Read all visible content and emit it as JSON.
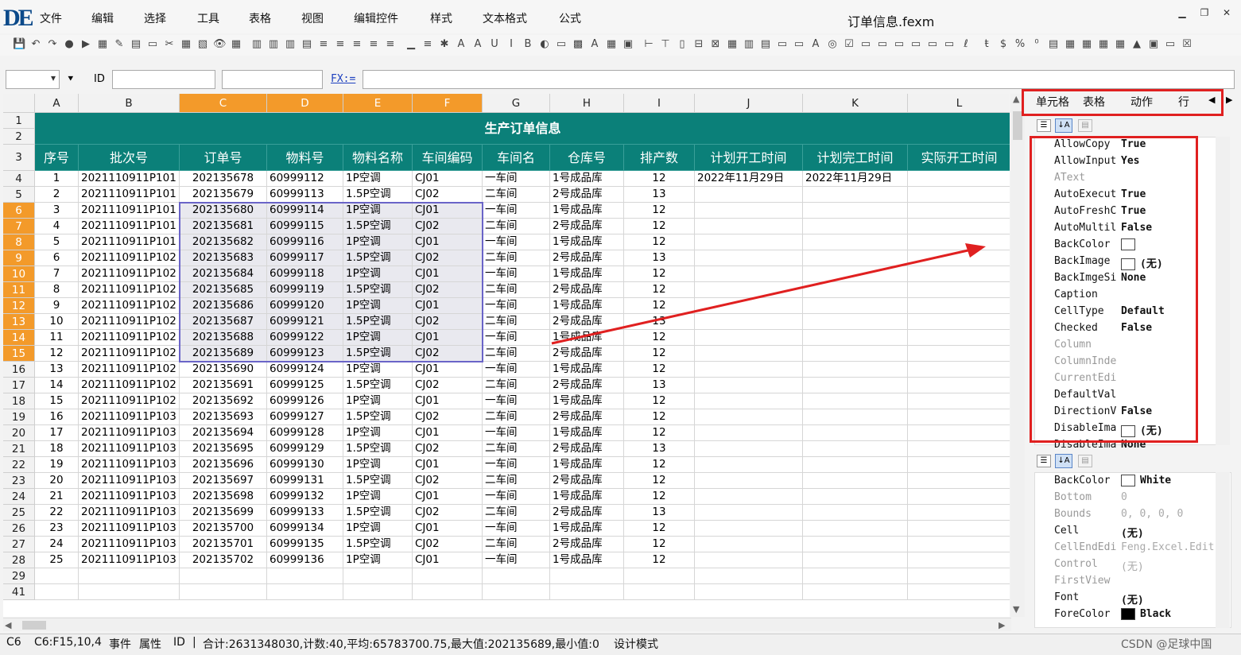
{
  "app": {
    "logo": "DE",
    "title": "订单信息.fexm"
  },
  "menu": [
    "文件",
    "编辑",
    "选择",
    "工具",
    "表格",
    "视图",
    "编辑控件",
    "样式",
    "文本格式",
    "公式"
  ],
  "formula_bar": {
    "id_label": "ID",
    "fx_label": "FX:=",
    "dropdown_arrow": "▾",
    "pin": "⯆"
  },
  "columns": [
    "A",
    "B",
    "C",
    "D",
    "E",
    "F",
    "G",
    "H",
    "I",
    "J",
    "K",
    "L"
  ],
  "sheet_title": "生产订单信息",
  "headers": [
    "序号",
    "批次号",
    "订单号",
    "物料号",
    "物料名称",
    "车间编码",
    "车间名",
    "仓库号",
    "排产数",
    "计划开工时间",
    "计划完工时间",
    "实际开工时间"
  ],
  "rows": [
    [
      "1",
      "2021110911P101",
      "202135678",
      "60999112",
      "1P空调",
      "CJ01",
      "一车间",
      "1号成品库",
      "12",
      "2022年11月29日",
      "2022年11月29日"
    ],
    [
      "2",
      "2021110911P101",
      "202135679",
      "60999113",
      "1.5P空调",
      "CJ02",
      "二车间",
      "2号成品库",
      "13",
      "",
      ""
    ],
    [
      "3",
      "2021110911P101",
      "202135680",
      "60999114",
      "1P空调",
      "CJ01",
      "一车间",
      "1号成品库",
      "12",
      "",
      ""
    ],
    [
      "4",
      "2021110911P101",
      "202135681",
      "60999115",
      "1.5P空调",
      "CJ02",
      "二车间",
      "2号成品库",
      "12",
      "",
      ""
    ],
    [
      "5",
      "2021110911P101",
      "202135682",
      "60999116",
      "1P空调",
      "CJ01",
      "一车间",
      "1号成品库",
      "12",
      "",
      ""
    ],
    [
      "6",
      "2021110911P102",
      "202135683",
      "60999117",
      "1.5P空调",
      "CJ02",
      "二车间",
      "2号成品库",
      "13",
      "",
      ""
    ],
    [
      "7",
      "2021110911P102",
      "202135684",
      "60999118",
      "1P空调",
      "CJ01",
      "一车间",
      "1号成品库",
      "12",
      "",
      ""
    ],
    [
      "8",
      "2021110911P102",
      "202135685",
      "60999119",
      "1.5P空调",
      "CJ02",
      "二车间",
      "2号成品库",
      "12",
      "",
      ""
    ],
    [
      "9",
      "2021110911P102",
      "202135686",
      "60999120",
      "1P空调",
      "CJ01",
      "一车间",
      "1号成品库",
      "12",
      "",
      ""
    ],
    [
      "10",
      "2021110911P102",
      "202135687",
      "60999121",
      "1.5P空调",
      "CJ02",
      "二车间",
      "2号成品库",
      "13",
      "",
      ""
    ],
    [
      "11",
      "2021110911P102",
      "202135688",
      "60999122",
      "1P空调",
      "CJ01",
      "一车间",
      "1号成品库",
      "12",
      "",
      ""
    ],
    [
      "12",
      "2021110911P102",
      "202135689",
      "60999123",
      "1.5P空调",
      "CJ02",
      "二车间",
      "2号成品库",
      "12",
      "",
      ""
    ],
    [
      "13",
      "2021110911P102",
      "202135690",
      "60999124",
      "1P空调",
      "CJ01",
      "一车间",
      "1号成品库",
      "12",
      "",
      ""
    ],
    [
      "14",
      "2021110911P102",
      "202135691",
      "60999125",
      "1.5P空调",
      "CJ02",
      "二车间",
      "2号成品库",
      "13",
      "",
      ""
    ],
    [
      "15",
      "2021110911P102",
      "202135692",
      "60999126",
      "1P空调",
      "CJ01",
      "一车间",
      "1号成品库",
      "12",
      "",
      ""
    ],
    [
      "16",
      "2021110911P103",
      "202135693",
      "60999127",
      "1.5P空调",
      "CJ02",
      "二车间",
      "2号成品库",
      "12",
      "",
      ""
    ],
    [
      "17",
      "2021110911P103",
      "202135694",
      "60999128",
      "1P空调",
      "CJ01",
      "一车间",
      "1号成品库",
      "12",
      "",
      ""
    ],
    [
      "18",
      "2021110911P103",
      "202135695",
      "60999129",
      "1.5P空调",
      "CJ02",
      "二车间",
      "2号成品库",
      "13",
      "",
      ""
    ],
    [
      "19",
      "2021110911P103",
      "202135696",
      "60999130",
      "1P空调",
      "CJ01",
      "一车间",
      "1号成品库",
      "12",
      "",
      ""
    ],
    [
      "20",
      "2021110911P103",
      "202135697",
      "60999131",
      "1.5P空调",
      "CJ02",
      "二车间",
      "2号成品库",
      "12",
      "",
      ""
    ],
    [
      "21",
      "2021110911P103",
      "202135698",
      "60999132",
      "1P空调",
      "CJ01",
      "一车间",
      "1号成品库",
      "12",
      "",
      ""
    ],
    [
      "22",
      "2021110911P103",
      "202135699",
      "60999133",
      "1.5P空调",
      "CJ02",
      "二车间",
      "2号成品库",
      "13",
      "",
      ""
    ],
    [
      "23",
      "2021110911P103",
      "202135700",
      "60999134",
      "1P空调",
      "CJ01",
      "一车间",
      "1号成品库",
      "12",
      "",
      ""
    ],
    [
      "24",
      "2021110911P103",
      "202135701",
      "60999135",
      "1.5P空调",
      "CJ02",
      "二车间",
      "2号成品库",
      "12",
      "",
      ""
    ],
    [
      "25",
      "2021110911P103",
      "202135702",
      "60999136",
      "1P空调",
      "CJ01",
      "一车间",
      "1号成品库",
      "12",
      "",
      ""
    ]
  ],
  "row_numbers": [
    "1",
    "2",
    "3",
    "4",
    "5",
    "6",
    "7",
    "8",
    "9",
    "10",
    "11",
    "12",
    "13",
    "14",
    "15",
    "16",
    "17",
    "18",
    "19",
    "20",
    "21",
    "22",
    "23",
    "24",
    "25",
    "26",
    "27",
    "28",
    "29",
    "41"
  ],
  "panel": {
    "tabs": [
      "单元格",
      "表格",
      "动作",
      "行"
    ],
    "cell_props": [
      {
        "name": "AllowCopy",
        "value": "True",
        "dim": false
      },
      {
        "name": "AllowInput",
        "value": "Yes",
        "dim": false
      },
      {
        "name": "AText",
        "value": "",
        "dim": true
      },
      {
        "name": "AutoExecut",
        "value": "True",
        "dim": false
      },
      {
        "name": "AutoFreshC",
        "value": "True",
        "dim": false
      },
      {
        "name": "AutoMultil",
        "value": "False",
        "dim": false
      },
      {
        "name": "BackColor",
        "value": "",
        "swatch": "#ffffff",
        "dim": false
      },
      {
        "name": "BackImage",
        "value": "(无)",
        "swatch": "#ffffff",
        "dim": false
      },
      {
        "name": "BackImgeSi",
        "value": "None",
        "dim": false
      },
      {
        "name": "Caption",
        "value": "",
        "dim": false
      },
      {
        "name": "CellType",
        "value": "Default",
        "dim": false
      },
      {
        "name": "Checked",
        "value": "False",
        "dim": false
      },
      {
        "name": "Column",
        "value": "",
        "dim": true
      },
      {
        "name": "ColumnInde",
        "value": "",
        "dim": true
      },
      {
        "name": "CurrentEdi",
        "value": "",
        "dim": true
      },
      {
        "name": "DefaultVal",
        "value": "",
        "dim": false
      },
      {
        "name": "DirectionV",
        "value": "False",
        "dim": false
      },
      {
        "name": "DisableIma",
        "value": "(无)",
        "swatch": "#ffffff",
        "dim": false
      },
      {
        "name": "DisableIma",
        "value": "None",
        "dim": false
      }
    ],
    "control_props": [
      {
        "name": "BackColor",
        "value": "White",
        "swatch": "#ffffff",
        "dim": false
      },
      {
        "name": "Bottom",
        "value": "0",
        "dim": true
      },
      {
        "name": "Bounds",
        "value": "0, 0, 0, 0",
        "dim": true
      },
      {
        "name": "Cell",
        "value": "(无)",
        "dim": false
      },
      {
        "name": "CellEndEdi",
        "value": "Feng.Excel.Edit",
        "dim": true
      },
      {
        "name": "Control",
        "value": "(无)",
        "dim": true
      },
      {
        "name": "FirstView",
        "value": "",
        "dim": true
      },
      {
        "name": "Font",
        "value": "(无)",
        "dim": false
      },
      {
        "name": "ForeColor",
        "value": "Black",
        "swatch": "#000000",
        "dim": false
      }
    ]
  },
  "status": {
    "cell": "C6",
    "range": "C6:F15,10,4",
    "events": "事件",
    "props": "属性",
    "id": "ID",
    "sep": "|",
    "summary": "合计:2631348030,计数:40,平均:65783700.75,最大值:202135689,最小值:0",
    "mode": "设计模式",
    "watermark": "CSDN @足球中国"
  },
  "colors": {
    "header": "#0b8079",
    "selected_header": "#f39a2a",
    "selection_border": "#6a64c8",
    "annotation": "#e02020"
  }
}
